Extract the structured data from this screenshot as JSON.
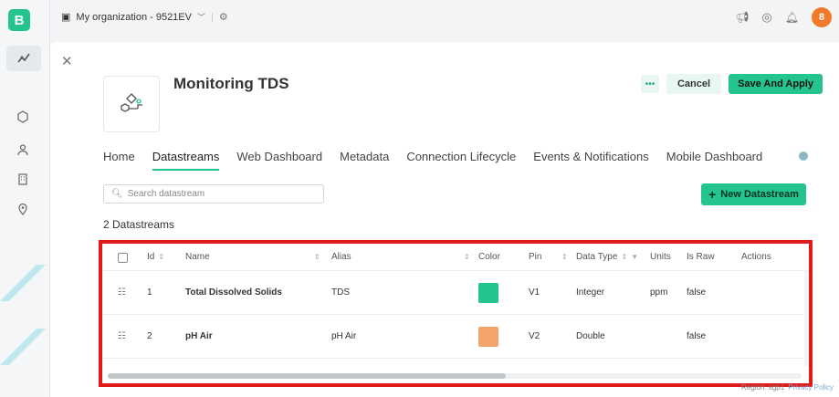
{
  "app": {
    "logo_letter": "B"
  },
  "topbar": {
    "org_name": "My organization - 9521EV",
    "avatar_letter": "8"
  },
  "template": {
    "title": "Monitoring TDS"
  },
  "header_buttons": {
    "more_label": "•••",
    "cancel_label": "Cancel",
    "save_label": "Save And Apply"
  },
  "tabs": [
    {
      "label": "Home"
    },
    {
      "label": "Datastreams",
      "active": true
    },
    {
      "label": "Web Dashboard"
    },
    {
      "label": "Metadata"
    },
    {
      "label": "Connection Lifecycle"
    },
    {
      "label": "Events & Notifications"
    },
    {
      "label": "Mobile Dashboard"
    }
  ],
  "search": {
    "placeholder": "Search datastream"
  },
  "new_datastream": {
    "label": "New Datastream"
  },
  "count_text": "2 Datastreams",
  "table": {
    "headers": {
      "id": "Id",
      "name": "Name",
      "alias": "Alias",
      "color": "Color",
      "pin": "Pin",
      "data_type": "Data Type",
      "units": "Units",
      "is_raw": "Is Raw",
      "actions": "Actions"
    },
    "rows": [
      {
        "id": "1",
        "name": "Total Dissolved Solids",
        "alias": "TDS",
        "color": "#23c48e",
        "pin": "V1",
        "data_type": "Integer",
        "units": "ppm",
        "is_raw": "false"
      },
      {
        "id": "2",
        "name": "pH Air",
        "alias": "pH Air",
        "color": "#f4a56c",
        "pin": "V2",
        "data_type": "Double",
        "units": "",
        "is_raw": "false"
      }
    ]
  },
  "footer": {
    "region": "Region: sgp1",
    "privacy": "Privacy Policy"
  },
  "colors": {
    "accent": "#23c48e",
    "highlight_border": "#e01b1b",
    "avatar": "#f07a2a"
  }
}
